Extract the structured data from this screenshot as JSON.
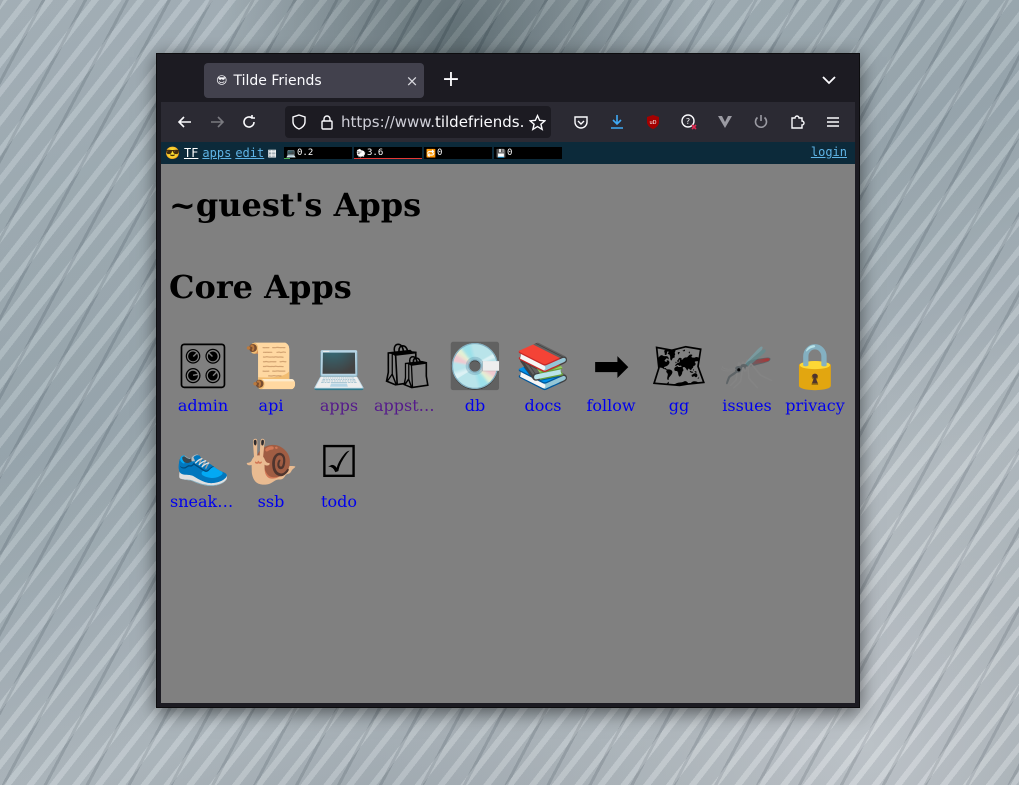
{
  "tab": {
    "title": "Tilde Friends",
    "favicon": "😎",
    "close_glyph": "×"
  },
  "newtab_glyph": "+",
  "url": {
    "scheme": "https://www.",
    "host": "tildefriends.net"
  },
  "topbar": {
    "emoji": "😎",
    "tf_label": "TF",
    "apps_label": "apps",
    "edit_label": "edit",
    "grid_glyph": "▦",
    "stats": [
      {
        "icon": "💻",
        "value": "0.2",
        "color": "#4caf50"
      },
      {
        "icon": "🐑",
        "value": "3.6",
        "color": "#e53935"
      },
      {
        "icon": "🔁",
        "value": "0",
        "color": "#2196f3"
      },
      {
        "icon": "💾",
        "value": "0",
        "color": "#9e9e9e"
      }
    ],
    "login_label": "login"
  },
  "page_title": "~guest's Apps",
  "section_title": "Core Apps",
  "apps": [
    {
      "icon": "🎛",
      "label": "admin",
      "visited": false
    },
    {
      "icon": "📜",
      "label": "api",
      "visited": false
    },
    {
      "icon": "💻",
      "label": "apps",
      "visited": true
    },
    {
      "icon": "🛍",
      "label": "appstore",
      "visited": true
    },
    {
      "icon": "💽",
      "label": "db",
      "visited": false
    },
    {
      "icon": "📚",
      "label": "docs",
      "visited": false
    },
    {
      "icon": "➡",
      "label": "follow",
      "visited": false
    },
    {
      "icon": "🗺",
      "label": "gg",
      "visited": false
    },
    {
      "icon": "🦟",
      "label": "issues",
      "visited": false
    },
    {
      "icon": "🔒",
      "label": "privacy",
      "visited": false
    },
    {
      "icon": "👟",
      "label": "sneakernet",
      "visited": false
    },
    {
      "icon": "🐌",
      "label": "ssb",
      "visited": false
    },
    {
      "icon": "☑",
      "label": "todo",
      "visited": false
    }
  ]
}
